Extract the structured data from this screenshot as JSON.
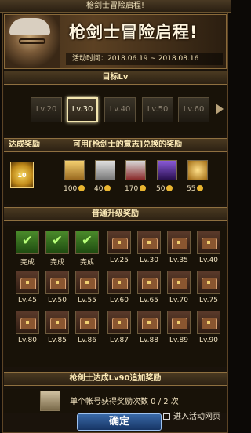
{
  "window": {
    "title": "枪剑士冒险启程!"
  },
  "banner": {
    "title": "枪剑士冒险启程!",
    "date": "活动时间：2018.06.19 ~ 2018.08.16"
  },
  "target_section": {
    "title": "目标Lv"
  },
  "levels": [
    "Lv.20",
    "Lv.30",
    "Lv.40",
    "Lv.50",
    "Lv.60"
  ],
  "reach": {
    "title": "达成奖励",
    "exchange_title": "可用[枪剑士的意志]兑换的奖励",
    "coin_label": "10",
    "rewards": [
      {
        "count": "100"
      },
      {
        "count": "40"
      },
      {
        "count": "170"
      },
      {
        "count": "50"
      },
      {
        "count": "55"
      }
    ]
  },
  "normal_section": {
    "title": "普通升级奖励"
  },
  "grid": {
    "row1": [
      {
        "label": "完成"
      },
      {
        "label": "完成"
      },
      {
        "label": "完成"
      },
      {
        "label": "Lv.25"
      },
      {
        "label": "Lv.30"
      },
      {
        "label": "Lv.35"
      },
      {
        "label": "Lv.40"
      }
    ],
    "row2": [
      {
        "label": "Lv.45"
      },
      {
        "label": "Lv.50"
      },
      {
        "label": "Lv.55"
      },
      {
        "label": "Lv.60"
      },
      {
        "label": "Lv.65"
      },
      {
        "label": "Lv.70"
      },
      {
        "label": "Lv.75"
      }
    ],
    "row3": [
      {
        "label": "Lv.80"
      },
      {
        "label": "Lv.85"
      },
      {
        "label": "Lv.86"
      },
      {
        "label": "Lv.87"
      },
      {
        "label": "Lv.88"
      },
      {
        "label": "Lv.89"
      },
      {
        "label": "Lv.90"
      }
    ]
  },
  "extra_section": {
    "title": "枪剑士达成Lv90追加奖励"
  },
  "extra": {
    "text": "单个帐号获得奖励次数  0 / 2 次"
  },
  "footer": {
    "confirm_label": "确定",
    "goto_label": "进入活动网页"
  }
}
